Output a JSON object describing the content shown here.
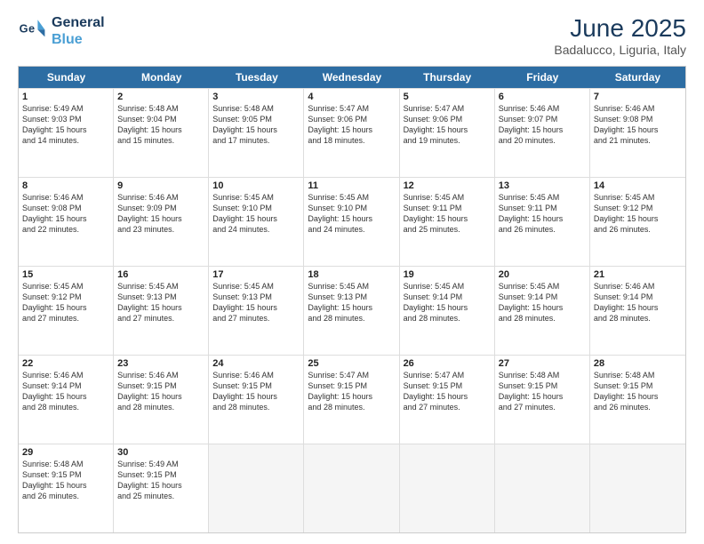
{
  "logo": {
    "line1": "General",
    "line2": "Blue"
  },
  "title": "June 2025",
  "subtitle": "Badalucco, Liguria, Italy",
  "days": [
    "Sunday",
    "Monday",
    "Tuesday",
    "Wednesday",
    "Thursday",
    "Friday",
    "Saturday"
  ],
  "rows": [
    [
      {
        "day": 1,
        "lines": [
          "Sunrise: 5:49 AM",
          "Sunset: 9:03 PM",
          "Daylight: 15 hours",
          "and 14 minutes."
        ]
      },
      {
        "day": 2,
        "lines": [
          "Sunrise: 5:48 AM",
          "Sunset: 9:04 PM",
          "Daylight: 15 hours",
          "and 15 minutes."
        ]
      },
      {
        "day": 3,
        "lines": [
          "Sunrise: 5:48 AM",
          "Sunset: 9:05 PM",
          "Daylight: 15 hours",
          "and 17 minutes."
        ]
      },
      {
        "day": 4,
        "lines": [
          "Sunrise: 5:47 AM",
          "Sunset: 9:06 PM",
          "Daylight: 15 hours",
          "and 18 minutes."
        ]
      },
      {
        "day": 5,
        "lines": [
          "Sunrise: 5:47 AM",
          "Sunset: 9:06 PM",
          "Daylight: 15 hours",
          "and 19 minutes."
        ]
      },
      {
        "day": 6,
        "lines": [
          "Sunrise: 5:46 AM",
          "Sunset: 9:07 PM",
          "Daylight: 15 hours",
          "and 20 minutes."
        ]
      },
      {
        "day": 7,
        "lines": [
          "Sunrise: 5:46 AM",
          "Sunset: 9:08 PM",
          "Daylight: 15 hours",
          "and 21 minutes."
        ]
      }
    ],
    [
      {
        "day": 8,
        "lines": [
          "Sunrise: 5:46 AM",
          "Sunset: 9:08 PM",
          "Daylight: 15 hours",
          "and 22 minutes."
        ]
      },
      {
        "day": 9,
        "lines": [
          "Sunrise: 5:46 AM",
          "Sunset: 9:09 PM",
          "Daylight: 15 hours",
          "and 23 minutes."
        ]
      },
      {
        "day": 10,
        "lines": [
          "Sunrise: 5:45 AM",
          "Sunset: 9:10 PM",
          "Daylight: 15 hours",
          "and 24 minutes."
        ]
      },
      {
        "day": 11,
        "lines": [
          "Sunrise: 5:45 AM",
          "Sunset: 9:10 PM",
          "Daylight: 15 hours",
          "and 24 minutes."
        ]
      },
      {
        "day": 12,
        "lines": [
          "Sunrise: 5:45 AM",
          "Sunset: 9:11 PM",
          "Daylight: 15 hours",
          "and 25 minutes."
        ]
      },
      {
        "day": 13,
        "lines": [
          "Sunrise: 5:45 AM",
          "Sunset: 9:11 PM",
          "Daylight: 15 hours",
          "and 26 minutes."
        ]
      },
      {
        "day": 14,
        "lines": [
          "Sunrise: 5:45 AM",
          "Sunset: 9:12 PM",
          "Daylight: 15 hours",
          "and 26 minutes."
        ]
      }
    ],
    [
      {
        "day": 15,
        "lines": [
          "Sunrise: 5:45 AM",
          "Sunset: 9:12 PM",
          "Daylight: 15 hours",
          "and 27 minutes."
        ]
      },
      {
        "day": 16,
        "lines": [
          "Sunrise: 5:45 AM",
          "Sunset: 9:13 PM",
          "Daylight: 15 hours",
          "and 27 minutes."
        ]
      },
      {
        "day": 17,
        "lines": [
          "Sunrise: 5:45 AM",
          "Sunset: 9:13 PM",
          "Daylight: 15 hours",
          "and 27 minutes."
        ]
      },
      {
        "day": 18,
        "lines": [
          "Sunrise: 5:45 AM",
          "Sunset: 9:13 PM",
          "Daylight: 15 hours",
          "and 28 minutes."
        ]
      },
      {
        "day": 19,
        "lines": [
          "Sunrise: 5:45 AM",
          "Sunset: 9:14 PM",
          "Daylight: 15 hours",
          "and 28 minutes."
        ]
      },
      {
        "day": 20,
        "lines": [
          "Sunrise: 5:45 AM",
          "Sunset: 9:14 PM",
          "Daylight: 15 hours",
          "and 28 minutes."
        ]
      },
      {
        "day": 21,
        "lines": [
          "Sunrise: 5:46 AM",
          "Sunset: 9:14 PM",
          "Daylight: 15 hours",
          "and 28 minutes."
        ]
      }
    ],
    [
      {
        "day": 22,
        "lines": [
          "Sunrise: 5:46 AM",
          "Sunset: 9:14 PM",
          "Daylight: 15 hours",
          "and 28 minutes."
        ]
      },
      {
        "day": 23,
        "lines": [
          "Sunrise: 5:46 AM",
          "Sunset: 9:15 PM",
          "Daylight: 15 hours",
          "and 28 minutes."
        ]
      },
      {
        "day": 24,
        "lines": [
          "Sunrise: 5:46 AM",
          "Sunset: 9:15 PM",
          "Daylight: 15 hours",
          "and 28 minutes."
        ]
      },
      {
        "day": 25,
        "lines": [
          "Sunrise: 5:47 AM",
          "Sunset: 9:15 PM",
          "Daylight: 15 hours",
          "and 28 minutes."
        ]
      },
      {
        "day": 26,
        "lines": [
          "Sunrise: 5:47 AM",
          "Sunset: 9:15 PM",
          "Daylight: 15 hours",
          "and 27 minutes."
        ]
      },
      {
        "day": 27,
        "lines": [
          "Sunrise: 5:48 AM",
          "Sunset: 9:15 PM",
          "Daylight: 15 hours",
          "and 27 minutes."
        ]
      },
      {
        "day": 28,
        "lines": [
          "Sunrise: 5:48 AM",
          "Sunset: 9:15 PM",
          "Daylight: 15 hours",
          "and 26 minutes."
        ]
      }
    ],
    [
      {
        "day": 29,
        "lines": [
          "Sunrise: 5:48 AM",
          "Sunset: 9:15 PM",
          "Daylight: 15 hours",
          "and 26 minutes."
        ]
      },
      {
        "day": 30,
        "lines": [
          "Sunrise: 5:49 AM",
          "Sunset: 9:15 PM",
          "Daylight: 15 hours",
          "and 25 minutes."
        ]
      },
      null,
      null,
      null,
      null,
      null
    ]
  ]
}
